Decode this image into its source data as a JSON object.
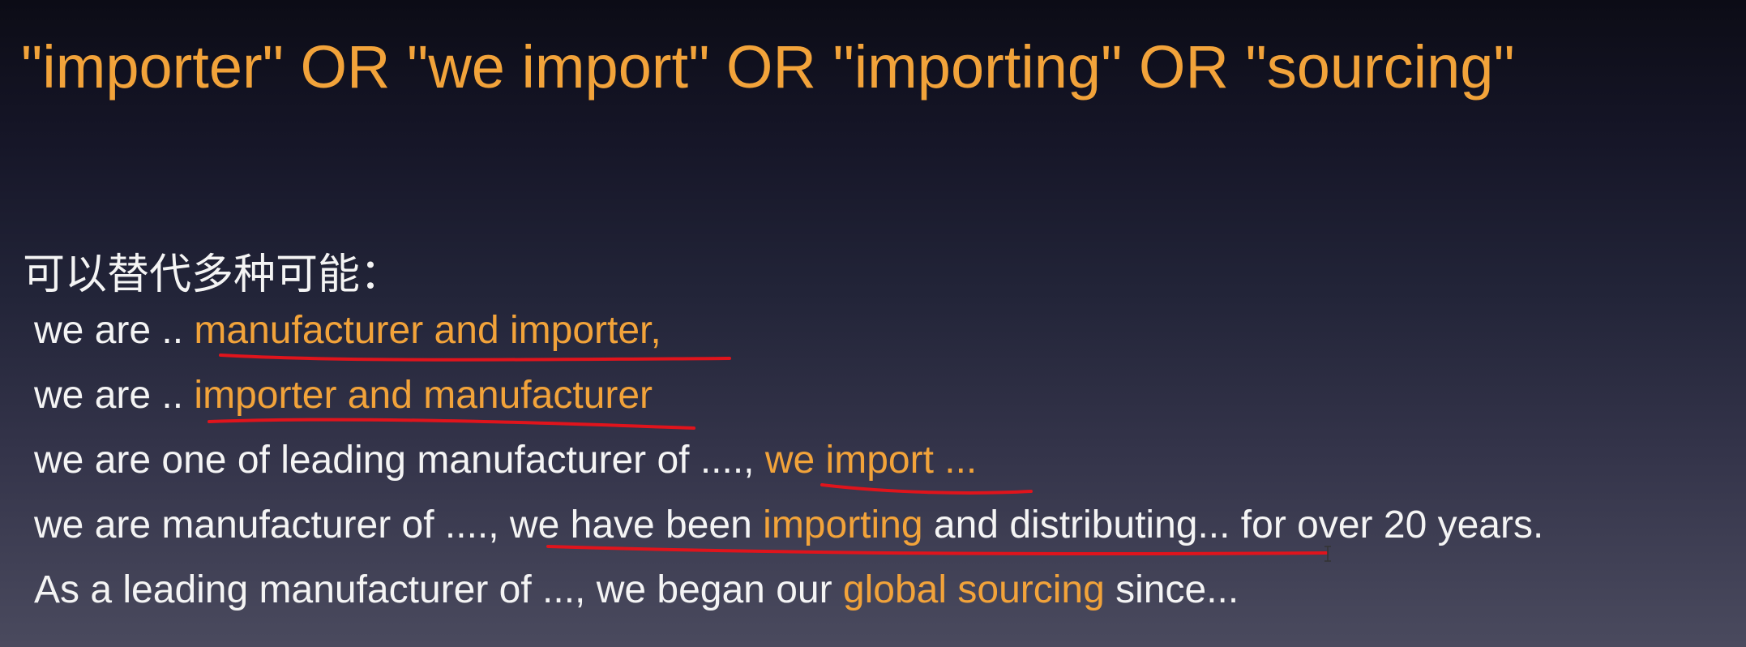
{
  "title": "\"importer\" OR \"we import\" OR \"importing\" OR \"sourcing\"",
  "subtitle": "可以替代多种可能：",
  "lines": [
    [
      {
        "text": "we are .. ",
        "hl": false
      },
      {
        "text": "manufacturer and importer,",
        "hl": true
      }
    ],
    [
      {
        "text": "we are .. ",
        "hl": false
      },
      {
        "text": "importer and manufacturer",
        "hl": true
      }
    ],
    [
      {
        "text": "we are one of leading manufacturer of ...., ",
        "hl": false
      },
      {
        "text": "we import ...",
        "hl": true
      }
    ],
    [
      {
        "text": "we are manufacturer of ...., we have been ",
        "hl": false
      },
      {
        "text": "importing",
        "hl": true
      },
      {
        "text": " and distributing... for over 20 years.",
        "hl": false
      }
    ],
    [
      {
        "text": "As a leading manufacturer of ..., we began our ",
        "hl": false
      },
      {
        "text": "global sourcing",
        "hl": true
      },
      {
        "text": " since...",
        "hl": false
      }
    ]
  ],
  "colors": {
    "highlight": "#f2a33a",
    "text": "#f4f4f4",
    "underline": "#e0141c"
  }
}
